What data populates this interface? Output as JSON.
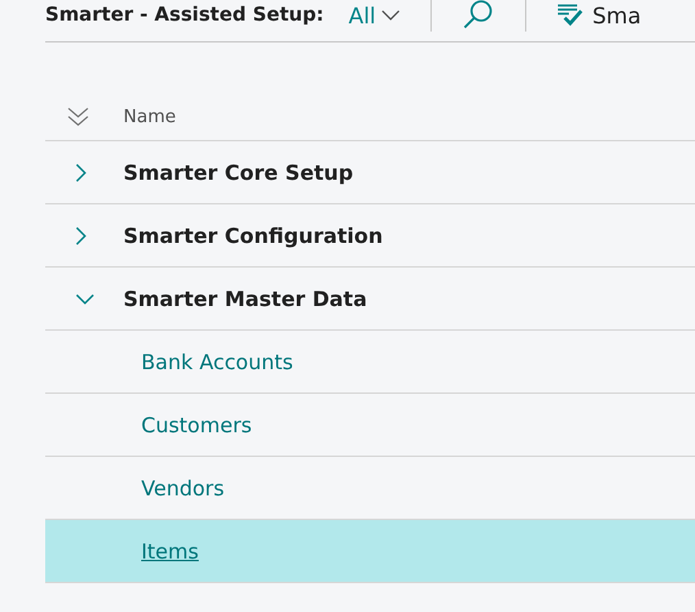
{
  "header": {
    "title": "Smarter - Assisted Setup:",
    "filter": "All",
    "action": "Sma"
  },
  "column": "Name",
  "groups": [
    {
      "label": "Smarter Core Setup",
      "expanded": false
    },
    {
      "label": "Smarter Configuration",
      "expanded": false
    },
    {
      "label": "Smarter Master Data",
      "expanded": true,
      "children": [
        {
          "label": "Bank Accounts",
          "selected": false
        },
        {
          "label": "Customers",
          "selected": false
        },
        {
          "label": "Vendors",
          "selected": false
        },
        {
          "label": "Items",
          "selected": true
        }
      ]
    }
  ]
}
